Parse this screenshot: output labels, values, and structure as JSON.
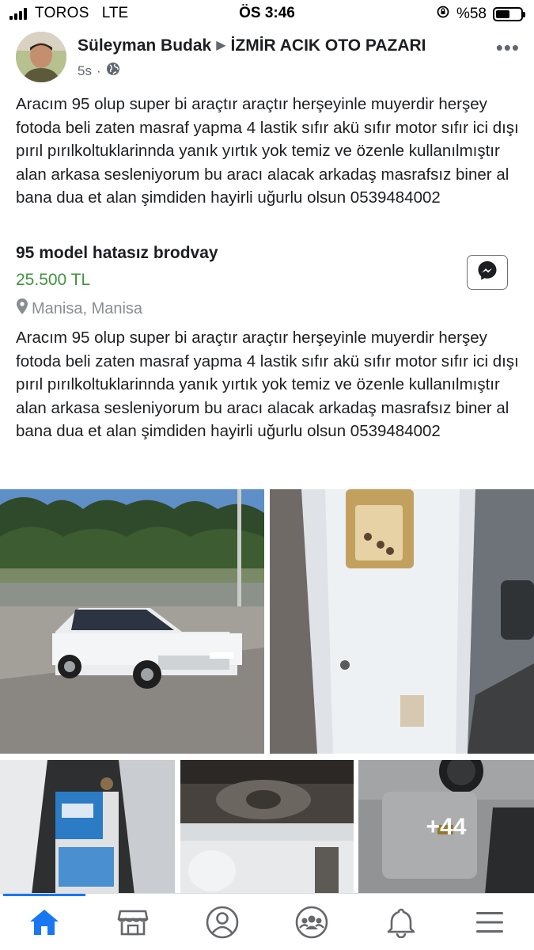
{
  "status_bar": {
    "carrier": "TOROS",
    "network": "LTE",
    "time": "ÖS 3:46",
    "battery": "%58",
    "battery_level": 0.58
  },
  "post": {
    "author": "Süleyman Budak",
    "group": "İZMİR ACIK OTO PAZARI",
    "time_ago": "5s",
    "privacy_icon": "globe-icon",
    "text": "Aracım 95 olup super bi araçtır araçtır herşeyinle muyerdir herşey fotoda beli zaten masraf yapma 4 lastik sıfır akü sıfır motor sıfır ici dışı pırıl pırılkoltuklarinnda yanık yırtık  yok temiz ve özenle kullanılmıştır alan arkasa sesleniyorum bu aracı alacak arkadaş masrafsız biner al bana dua et alan şimdiden hayirli uğurlu olsun 0539484002"
  },
  "listing": {
    "title": "95 model hatasız brodvay",
    "price": "25.500 TL",
    "location": "Manisa, Manisa",
    "description": "Aracım 95 olup super bi araçtır araçtır herşeyinle muyerdir herşey fotoda beli zaten masraf yapma 4 lastik sıfır akü sıfır motor sıfır ici dışı pırıl pırılkoltuklarinnda yanık yırtık  yok temiz ve özenle kullanılmıştır alan arkasa sesleniyorum bu aracı alacak arkadaş masrafsız biner al bana dua et alan şimdiden hayirli uğurlu olsun 0539484002"
  },
  "photos": {
    "more_count": "+44"
  },
  "nav": {
    "items": [
      "home-icon",
      "marketplace-icon",
      "profile-icon",
      "groups-icon",
      "notifications-icon",
      "menu-icon"
    ],
    "active": "home-icon"
  },
  "colors": {
    "price_green": "#42923f",
    "active_blue": "#1877f2",
    "text_gray": "#606770"
  }
}
